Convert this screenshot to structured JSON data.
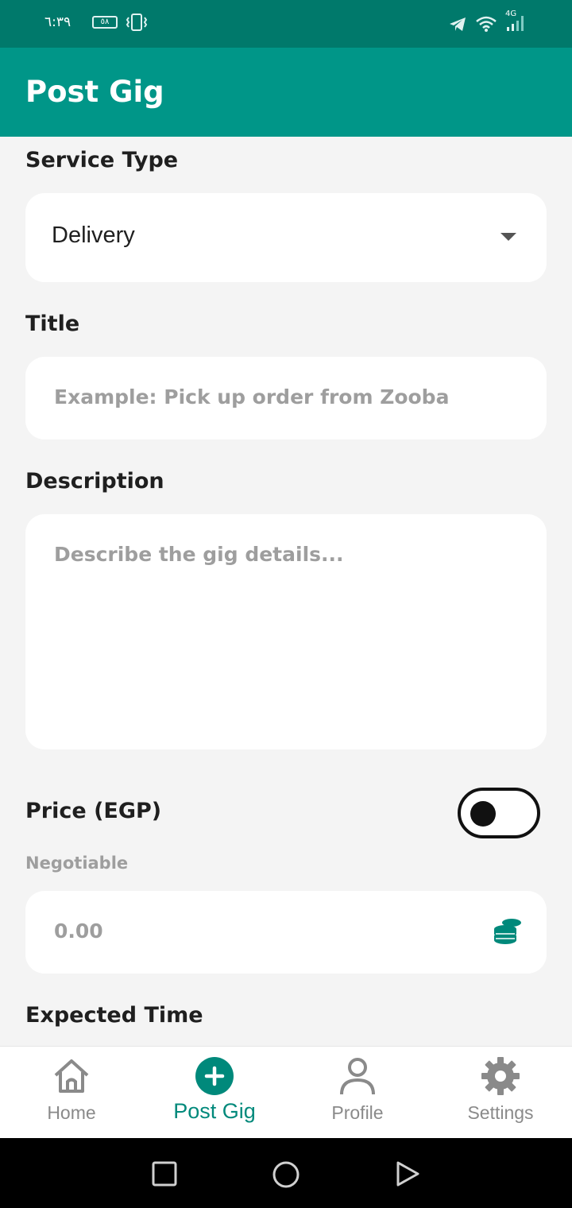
{
  "status_bar": {
    "time": "٦:٣٩",
    "battery": "٥٨",
    "network": "4G"
  },
  "app_bar": {
    "title": "Post Gig"
  },
  "form": {
    "service_type": {
      "label": "Service Type",
      "value": "Delivery"
    },
    "title": {
      "label": "Title",
      "placeholder": "Example: Pick up order from Zooba"
    },
    "description": {
      "label": "Description",
      "placeholder": "Describe the gig details..."
    },
    "price": {
      "label": "Price (EGP)",
      "negotiable_label": "Negotiable",
      "negotiable_on": false,
      "placeholder": "0.00"
    },
    "expected_time": {
      "label": "Expected Time"
    }
  },
  "bottom_nav": {
    "items": [
      {
        "label": "Home",
        "icon": "home-icon",
        "active": false
      },
      {
        "label": "Post Gig",
        "icon": "add-circle-icon",
        "active": true
      },
      {
        "label": "Profile",
        "icon": "person-icon",
        "active": false
      },
      {
        "label": "Settings",
        "icon": "gear-icon",
        "active": false
      }
    ]
  },
  "colors": {
    "primary": "#009688",
    "status_bar": "#00796b",
    "background": "#f4f4f4",
    "active_nav": "#00897b"
  }
}
